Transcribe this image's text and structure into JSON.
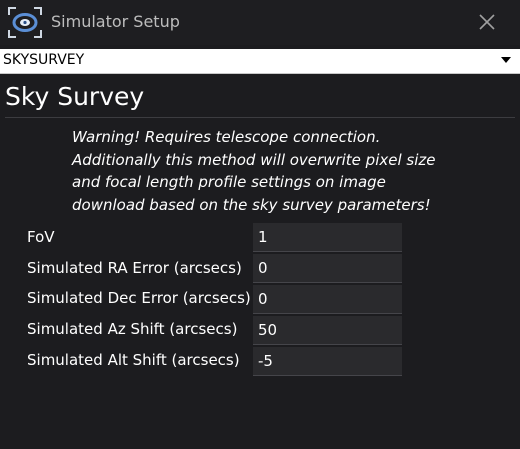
{
  "window": {
    "title": "Simulator Setup",
    "icon": "telescope-app-icon",
    "close_icon": "close-icon"
  },
  "camera_type": {
    "selected": "SKYSURVEY"
  },
  "section": {
    "title": "Sky Survey"
  },
  "warning_lines": [
    "Warning! Requires telescope connection.",
    "Additionally this method will overwrite pixel size",
    "and focal length profile settings on image",
    "download based on the sky survey parameters!"
  ],
  "fields": [
    {
      "label": "FoV",
      "value": "1"
    },
    {
      "label": "Simulated RA Error (arcsecs)",
      "value": "0"
    },
    {
      "label": "Simulated Dec Error (arcsecs)",
      "value": "0"
    },
    {
      "label": "Simulated Az Shift (arcsecs)",
      "value": "50"
    },
    {
      "label": "Simulated Alt Shift (arcsecs)",
      "value": "-5"
    }
  ],
  "colors": {
    "background": "#1c1c1f",
    "input_background": "#2a2a2d",
    "accent_icon": "#5b8fd6"
  }
}
